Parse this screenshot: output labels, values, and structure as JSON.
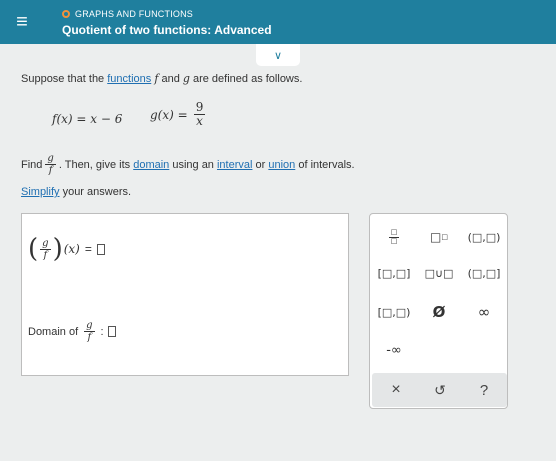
{
  "header": {
    "menu_icon": "≡",
    "topic": "GRAPHS AND FUNCTIONS",
    "title": "Quotient of two functions: Advanced"
  },
  "collapse_icon": "∨",
  "problem": {
    "intro_pre": "Suppose that the ",
    "intro_link": "functions",
    "intro_f": "f",
    "intro_and": " and ",
    "intro_g": "g",
    "intro_post": " are defined as follows.",
    "f_def": "f(x) = x − 6",
    "g_lhs": "g(x) =",
    "g_num": "9",
    "g_den": "x",
    "find_pre": "Find",
    "frac_num": "g",
    "frac_den": "f",
    "find_mid": ". Then, give its ",
    "domain_link": "domain",
    "find_using": " using an ",
    "interval_link": "interval",
    "find_or": " or ",
    "union_link": "union",
    "find_post": " of intervals.",
    "simplify_link": "Simplify",
    "simplify_post": " your answers."
  },
  "answer": {
    "quotient_open": "(",
    "quotient_close": ")",
    "quotient_arg": "(x)",
    "equals": "=",
    "domain_label": "Domain of",
    "colon": ":"
  },
  "keypad": {
    "keys": {
      "fraction": "□/□",
      "exponent": "□□",
      "open_open": "(□,□)",
      "closed_closed": "[□,□]",
      "union": "□∪□",
      "open_closed": "(□,□]",
      "closed_open": "[□,□)",
      "empty_set": "Ø",
      "infinity": "∞",
      "neg_infinity": "-∞"
    },
    "bottom": {
      "clear": "×",
      "undo": "↺",
      "help": "?"
    }
  }
}
